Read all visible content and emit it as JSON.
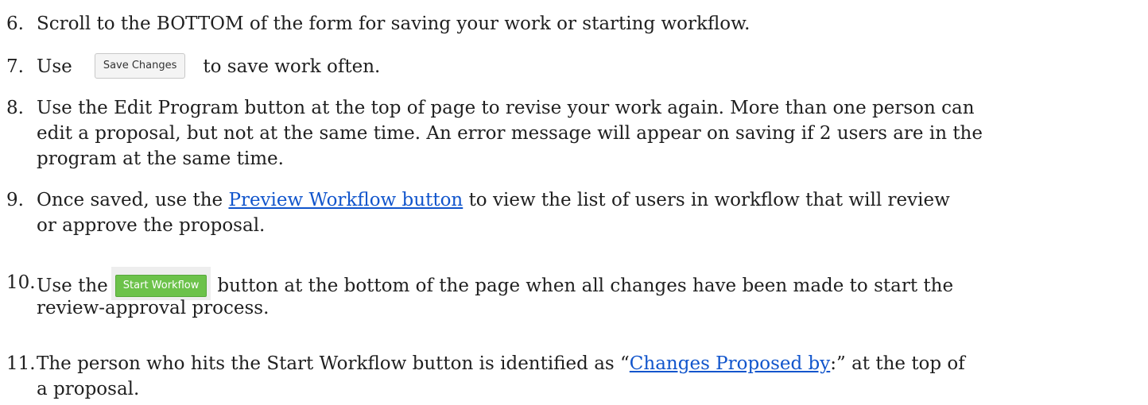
{
  "items": [
    {
      "number": "6.",
      "lines": [
        "Scroll to the BOTTOM of the form for saving your work or starting workflow."
      ]
    },
    {
      "number": "7.",
      "before": "Use",
      "button_label": "Save Changes",
      "after": "to save work often."
    },
    {
      "number": "8.",
      "lines": [
        "Use the Edit Program button at the top of page to revise your work again. More than one person can",
        "edit a proposal, but not at the same time. An error message will appear on saving if 2 users are in the",
        "program at the same time."
      ]
    },
    {
      "number": "9.",
      "before": "Once saved, use the",
      "link": "Preview Workflow button",
      "after": "to view the list of users in workflow that will review",
      "line2": "or approve the proposal."
    },
    {
      "number": "10.",
      "before": "Use the",
      "button_label": "Start Workflow",
      "after": "button at the bottom of the page when all changes have been made to start the",
      "line2": "review-approval process."
    },
    {
      "number": "11.",
      "before": "The person who hits the Start Workflow button is identified as “",
      "link": "Changes Proposed by",
      "after": ":” at the top of",
      "line2": "a proposal."
    }
  ],
  "colors": {
    "link": "#1155cc",
    "start_button": "#6cc24a",
    "text": "#1f1f1f"
  }
}
